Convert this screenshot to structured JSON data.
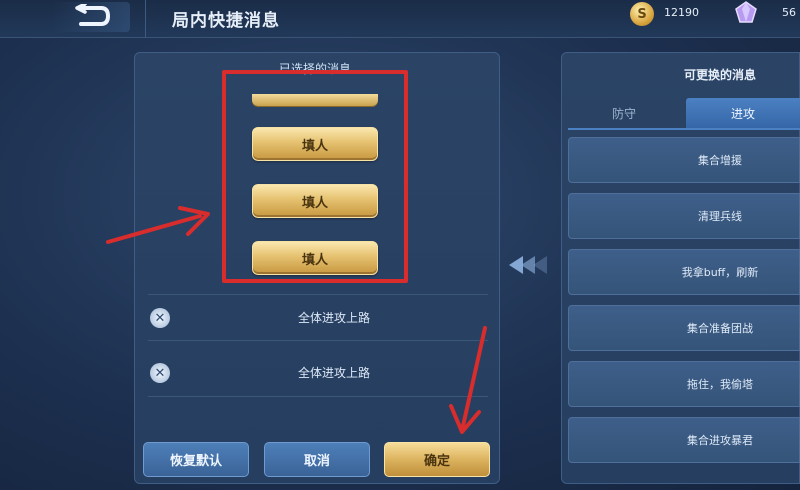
{
  "header": {
    "title": "局内快捷消息",
    "coin_count": "12190",
    "coin_symbol": "S",
    "gem_count": "56"
  },
  "left_panel": {
    "title": "已选择的消息",
    "slots": [
      "填人",
      "填人",
      "填人"
    ],
    "messages": [
      "全体进攻上路",
      "全体进攻上路"
    ],
    "remove_symbol": "✕"
  },
  "buttons": {
    "reset": "恢复默认",
    "cancel": "取消",
    "confirm": "确定"
  },
  "right_panel": {
    "title": "可更换的消息",
    "tabs": [
      "防守",
      "进攻"
    ],
    "active_tab": "进攻",
    "options": [
      "集合增援",
      "清理兵线",
      "我拿buff，刷新",
      "集合准备团战",
      "拖住，我偷塔",
      "集合进攻暴君"
    ]
  },
  "colors": {
    "highlight_red": "#d92c2c",
    "gold_button": "#e5c170",
    "blue_button": "#3a6398",
    "active_tab": "#4b80c2"
  },
  "icons": {
    "back": "back-arrow-icon",
    "coin": "coin-icon",
    "gem": "gem-icon",
    "remove": "remove-icon",
    "swap": "swap-arrow-icon"
  }
}
